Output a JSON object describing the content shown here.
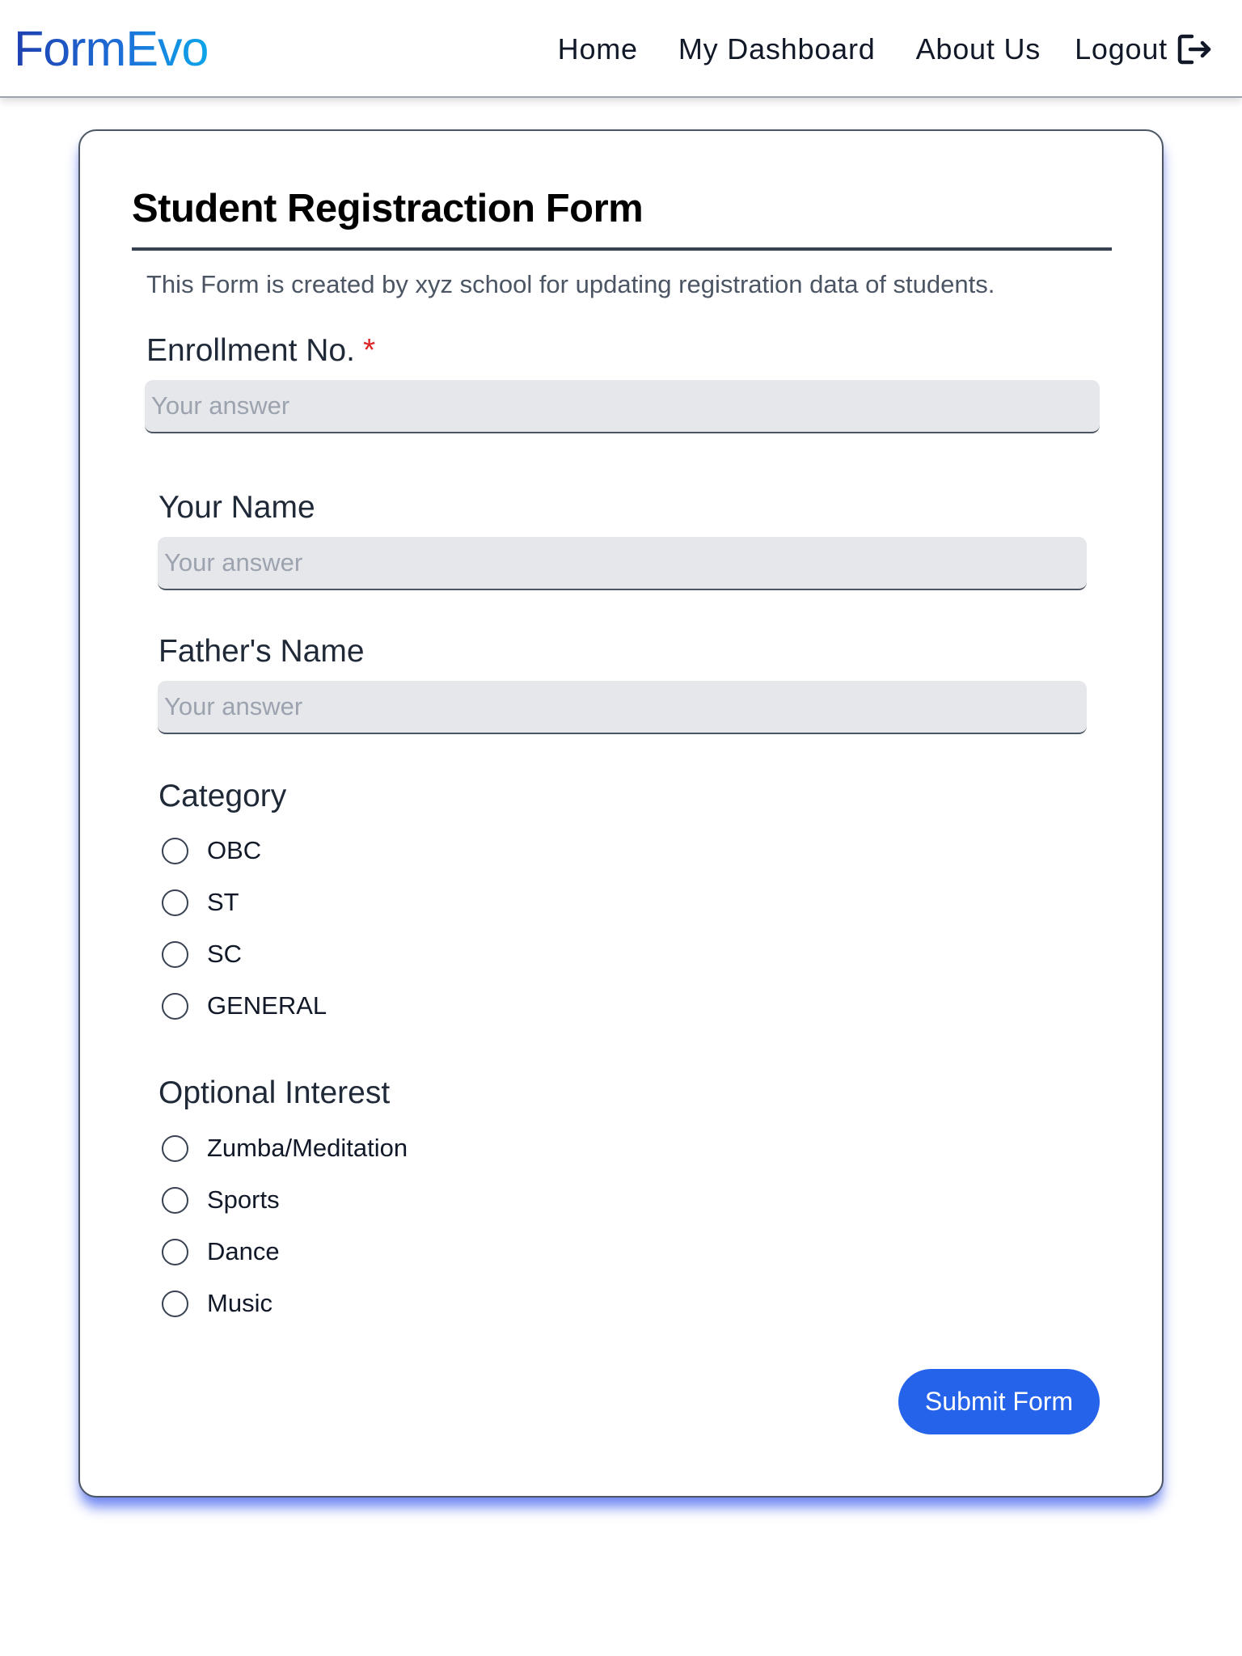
{
  "nav": {
    "logo": "FormEvo",
    "links": {
      "home": "Home",
      "dashboard": "My Dashboard",
      "about": "About Us",
      "logout": "Logout"
    }
  },
  "form": {
    "title": "Student Registraction Form",
    "description": "This Form is created by xyz school for updating registration data of students.",
    "fields": {
      "enrollment": {
        "label": "Enrollment No.",
        "required_mark": "*",
        "placeholder": "Your answer",
        "value": ""
      },
      "name": {
        "label": "Your Name",
        "placeholder": "Your answer",
        "value": ""
      },
      "father": {
        "label": "Father's Name",
        "placeholder": "Your answer",
        "value": ""
      }
    },
    "category": {
      "label": "Category",
      "options": [
        "OBC",
        "ST",
        "SC",
        "GENERAL"
      ],
      "selected": null
    },
    "interest": {
      "label": "Optional Interest",
      "options": [
        "Zumba/Meditation",
        "Sports",
        "Dance",
        "Music"
      ],
      "selected": null
    },
    "submit_label": "Submit Form"
  },
  "colors": {
    "accent": "#2563eb",
    "required": "#dc2626",
    "input_bg": "#e5e7eb",
    "card_shadow": "#4361ee"
  }
}
